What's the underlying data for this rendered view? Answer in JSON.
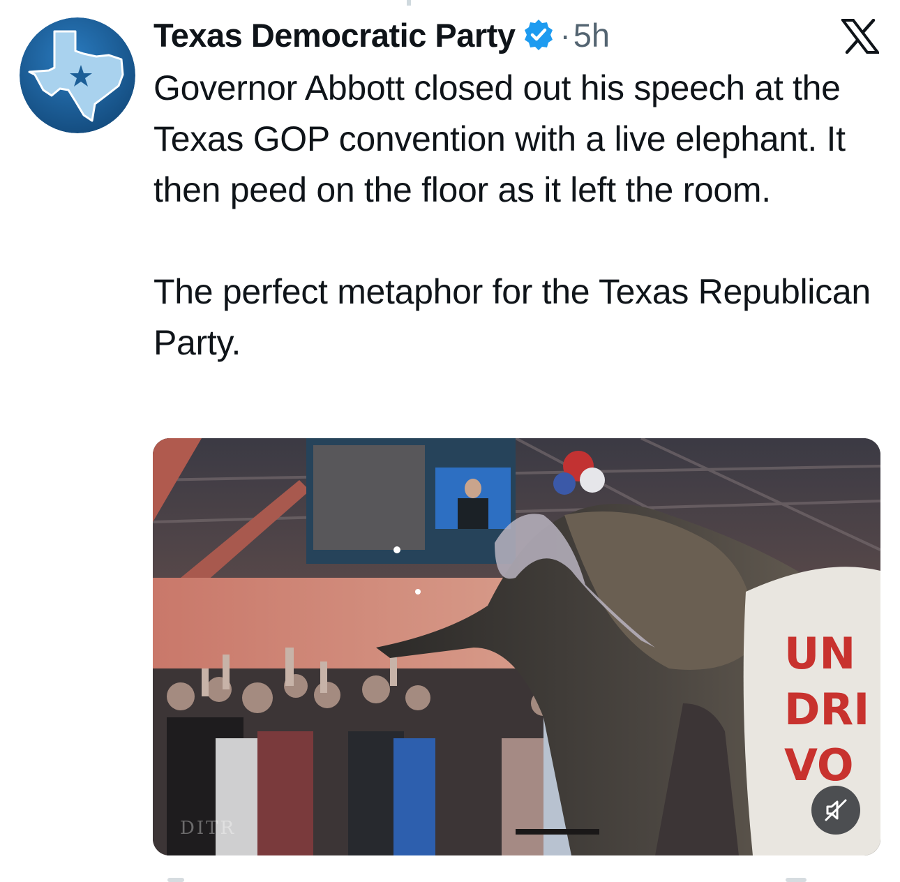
{
  "author": {
    "name": "Texas Democratic Party",
    "verified": true,
    "separator": "·",
    "time": "5h",
    "avatar_icon": "texas-star-icon"
  },
  "platform_icon": "x-logo-icon",
  "tweet": {
    "text": "Governor Abbott closed out his speech at the Texas GOP convention with a live elephant. It then peed on the floor as it left the room.\n\nThe perfect metaphor for the Texas Republican Party."
  },
  "media": {
    "type": "video",
    "mute_icon": "speaker-muted-icon",
    "banner_text": "UN DRI VO",
    "watermark_text": "DITR"
  },
  "colors": {
    "verified_blue": "#1d9bf0",
    "avatar_blue": "#1b5e97",
    "avatar_light": "#9ccbe8",
    "text_secondary": "#536471"
  }
}
